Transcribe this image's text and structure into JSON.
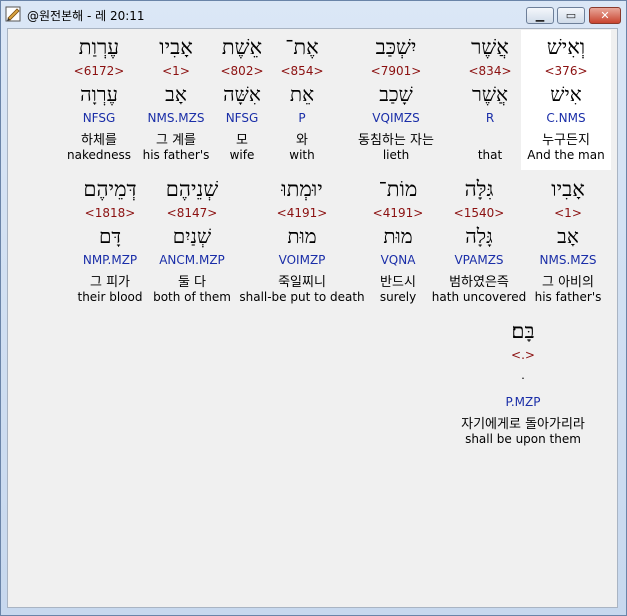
{
  "window": {
    "title": "@원전본해 - 레 20:11"
  },
  "rows": [
    {
      "words": [
        {
          "heb": "וְאִישׁ",
          "strong": "<376>",
          "lemma": "אִישׁ",
          "morph": "C.NMS",
          "kor": "누구든지",
          "eng": "And the man",
          "highlight": true
        },
        {
          "heb": "אֲשֶׁר",
          "strong": "<834>",
          "lemma": "אֲשֶׁר",
          "morph": "R",
          "kor": "",
          "eng": "that"
        },
        {
          "heb": "יִשְׁכַּב",
          "strong": "<7901>",
          "lemma": "שָׁכַב",
          "morph": "VQIMZS",
          "kor": "동침하는 자는",
          "eng": "lieth"
        },
        {
          "heb": "אֶת־",
          "strong": "<854>",
          "lemma": "אֵת",
          "morph": "P",
          "kor": "와",
          "eng": "with"
        },
        {
          "heb": "אֵשֶׁת",
          "strong": "<802>",
          "lemma": "אִשָּׁה",
          "morph": "NFSG",
          "kor": "모",
          "eng": "wife"
        },
        {
          "heb": "אָבִיו",
          "strong": "<1>",
          "lemma": "אָב",
          "morph": "NMS.MZS",
          "kor": "그 계를",
          "eng": "his father's"
        },
        {
          "heb": "עֶרְוַת",
          "strong": "<6172>",
          "lemma": "עֶרְוָה",
          "morph": "NFSG",
          "kor": "하체를",
          "eng": "nakedness"
        }
      ]
    },
    {
      "words": [
        {
          "heb": "אָבִיו",
          "strong": "<1>",
          "lemma": "אָב",
          "morph": "NMS.MZS",
          "kor": "그 아비의",
          "eng": "his father's"
        },
        {
          "heb": "גִּלָּה",
          "strong": "<1540>",
          "lemma": "גָּלָה",
          "morph": "VPAMZS",
          "kor": "범하였은즉",
          "eng": "hath uncovered"
        },
        {
          "heb": "מוֹת־",
          "strong": "<4191>",
          "lemma": "מוּת",
          "morph": "VQNA",
          "kor": "반드시",
          "eng": "surely"
        },
        {
          "heb": "יוּמְתוּ",
          "strong": "<4191>",
          "lemma": "מוּת",
          "morph": "VOIMZP",
          "kor": "죽일찌니",
          "eng": "shall-be put to death"
        },
        {
          "heb": "שְׁנֵיהֶם",
          "strong": "<8147>",
          "lemma": "שְׁנַיִם",
          "morph": "ANCM.MZP",
          "kor": "둘 다",
          "eng": "both of them"
        },
        {
          "heb": "דְּמֵיהֶם",
          "strong": "<1818>",
          "lemma": "דָּם",
          "morph": "NMP.MZP",
          "kor": "그 피가",
          "eng": "their blood"
        }
      ]
    },
    {
      "words": [
        {
          "heb": "בָּם׃",
          "strong": "<.>",
          "lemma": "ּ",
          "morph": "P.MZP",
          "kor": "자기에게로 돌아가리라",
          "eng": "shall be upon them"
        }
      ]
    }
  ]
}
